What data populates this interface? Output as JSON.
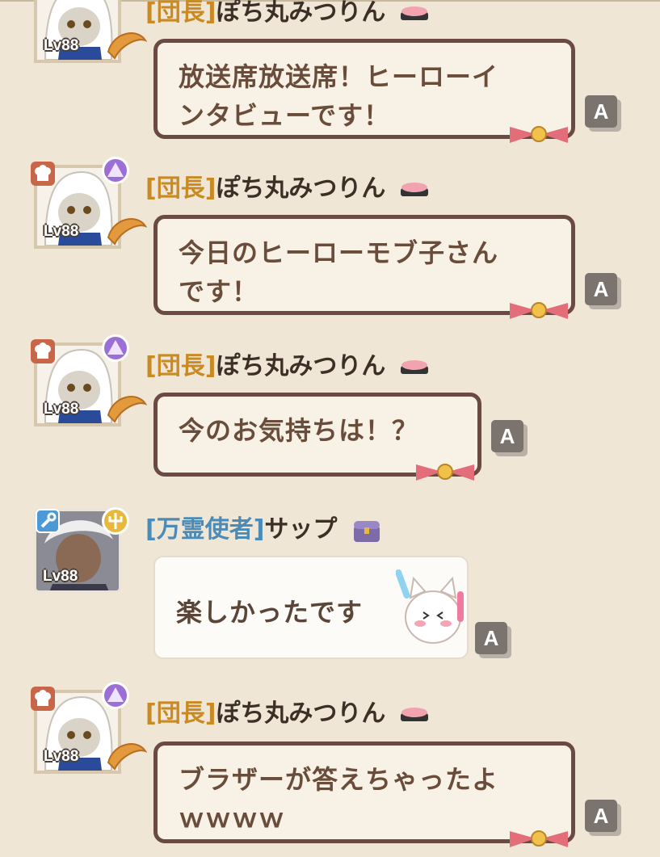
{
  "messages": [
    {
      "rank_tag": "[団長]",
      "name": "ぽち丸みつりん",
      "level": "Lv88",
      "text_lines": [
        "放送席放送席！ヒーローイ",
        "ンタビューです！"
      ]
    },
    {
      "rank_tag": "[団長]",
      "name": "ぽち丸みつりん",
      "level": "Lv88",
      "text_lines": [
        "今日のヒーローモブ子さん",
        "です！"
      ]
    },
    {
      "rank_tag": "[団長]",
      "name": "ぽち丸みつりん",
      "level": "Lv88",
      "text_lines": [
        "今のお気持ちは！？"
      ]
    },
    {
      "rank_tag": "[万霊使者]",
      "name": "サップ",
      "level": "Lv88",
      "text_lines": [
        "楽しかったです"
      ]
    },
    {
      "rank_tag": "[団長]",
      "name": "ぽち丸みつりん",
      "level": "Lv88",
      "text_lines": [
        "ブラザーが答えちゃったよ",
        "ｗｗｗｗ"
      ]
    }
  ],
  "translate_button_label": "A",
  "colors": {
    "background": "#efe6d6",
    "leader_tag": "#c98a24",
    "member_tag": "#4b8bb8",
    "bubble_border": "#6b4a43",
    "bubble_fill": "#f8f2e6",
    "name_text": "#3d2f26"
  },
  "icons": {
    "leader_badge": "chef-hat-icon",
    "role_badge": "purple-gem-icon",
    "member_badge": "wrench-icon",
    "member_role_badge": "gold-trident-icon",
    "name_deco_leader": "sushi-icon",
    "name_deco_member": "treasure-chest-icon",
    "avatar_accessory": "croissant-icon",
    "bubble_deco": "bell-bow-icon",
    "sticker": "cheering-cat-sticker"
  }
}
